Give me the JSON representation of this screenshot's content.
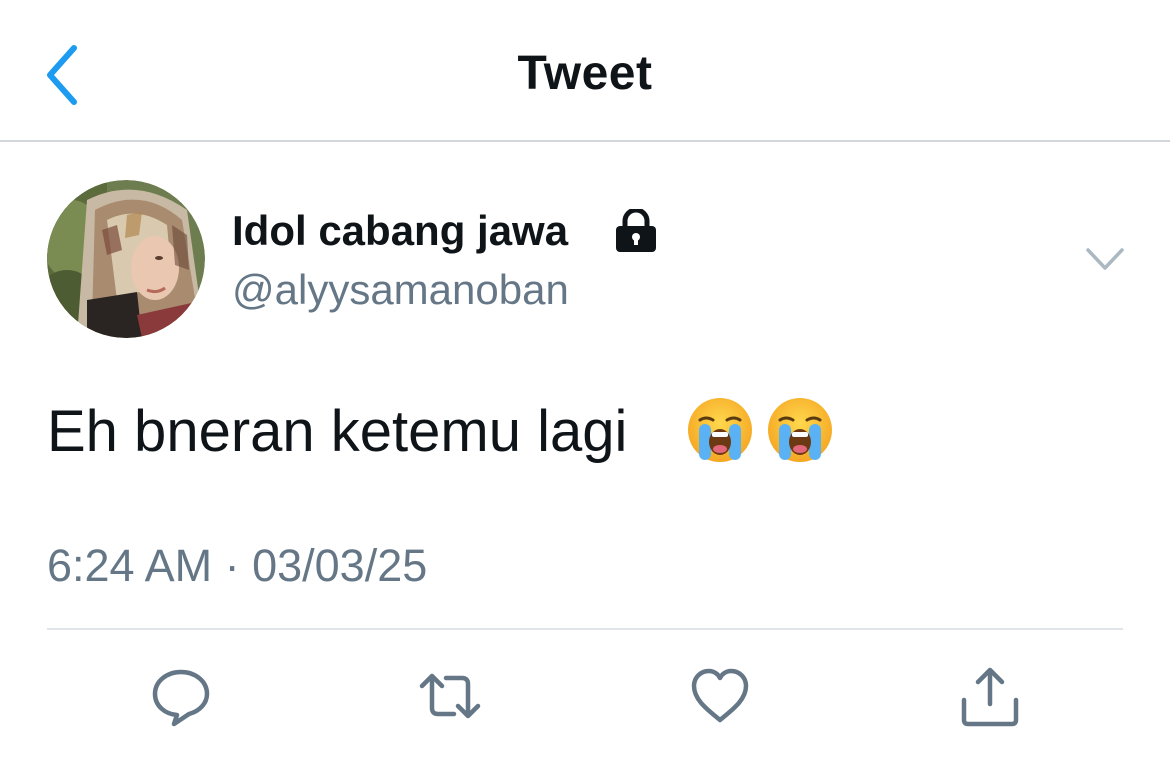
{
  "header": {
    "title": "Tweet",
    "back_icon": "chevron-left-icon",
    "accent_color": "#1d9bf0"
  },
  "tweet": {
    "author": {
      "display_name": "Idol cabang jawa",
      "handle": "@alyysamanoban",
      "protected_icon": "lock-icon"
    },
    "text": "Eh bneran ketemu lagi",
    "emojis": [
      "loudly-crying-face",
      "loudly-crying-face"
    ],
    "timestamp": "6:24 AM · 03/03/25",
    "more_icon": "chevron-down-icon"
  },
  "actions": [
    {
      "icon": "reply-icon"
    },
    {
      "icon": "retweet-icon"
    },
    {
      "icon": "like-icon"
    },
    {
      "icon": "share-icon"
    }
  ],
  "colors": {
    "text_primary": "#0f1419",
    "text_secondary": "#657786",
    "icon_gray": "#657786",
    "divider": "#e1e5e9"
  }
}
